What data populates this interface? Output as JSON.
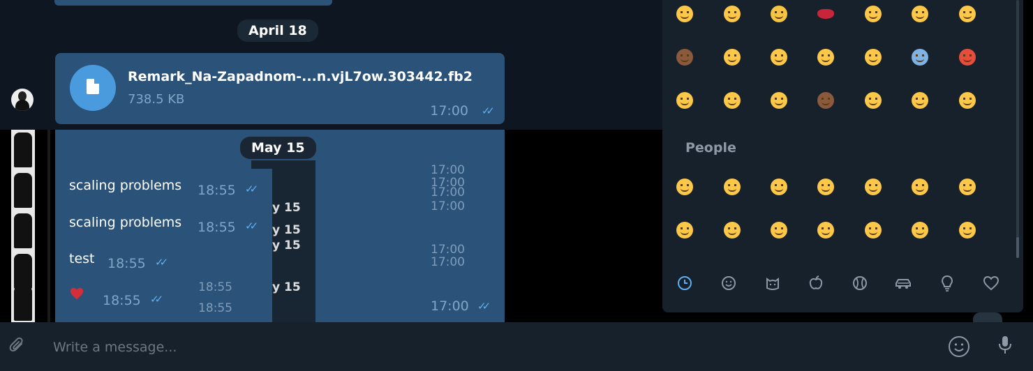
{
  "date_separators": [
    "April 18",
    "May 15"
  ],
  "file_message": {
    "name": "Remark_Na-Zapadnom-...n.vjL7ow.303442.fb2",
    "size": "738.5 KB",
    "time": "17:00"
  },
  "messages": [
    {
      "text": "scaling problems",
      "time": "18:55"
    },
    {
      "text": "scaling problems",
      "time": "18:55"
    },
    {
      "text": "test",
      "time": "18:55"
    },
    {
      "text": "heart",
      "time": "18:55"
    }
  ],
  "ghost_times": [
    "17:00",
    "17:00",
    "17:00",
    "17:00",
    "17:00",
    "17:00",
    "18:55",
    "18:55"
  ],
  "ghost_dates": [
    "y 15",
    "y 15",
    "y 15",
    "y 15"
  ],
  "bottom_right_time": "17:00",
  "emoji_panel": {
    "section_people": "People",
    "recent_rows": [
      [
        "smirk",
        "grin",
        "sob",
        "kiss-lips",
        "unamused",
        "flushed",
        "tongue-wink"
      ],
      [
        "see-no-evil-monkey",
        "wink",
        "smiley",
        "cry",
        "squint-tongue",
        "scream",
        "angry"
      ],
      [
        "disappointed",
        "sweat-smile",
        "relaxed",
        "monkey",
        "relieved",
        "grin",
        "yum"
      ]
    ],
    "people_rows": [
      [
        "grinning",
        "smiley",
        "smile",
        "grin",
        "laughing",
        "sweat-smile",
        "joy"
      ],
      [
        "rofl",
        "relaxed",
        "blush",
        "innocent",
        "slight-smile",
        "upside-down",
        "wink"
      ]
    ],
    "categories": [
      "recent-clock",
      "smileys",
      "animals",
      "food",
      "activity",
      "travel",
      "objects",
      "symbols"
    ],
    "active_category": "recent-clock"
  },
  "composer": {
    "placeholder": "Write a message..."
  },
  "colors": {
    "bubble": "#2b5278",
    "background": "#0e1621",
    "panel": "#17212b",
    "accent": "#5fb0f0",
    "emoji_yellow": "#fdc847"
  }
}
